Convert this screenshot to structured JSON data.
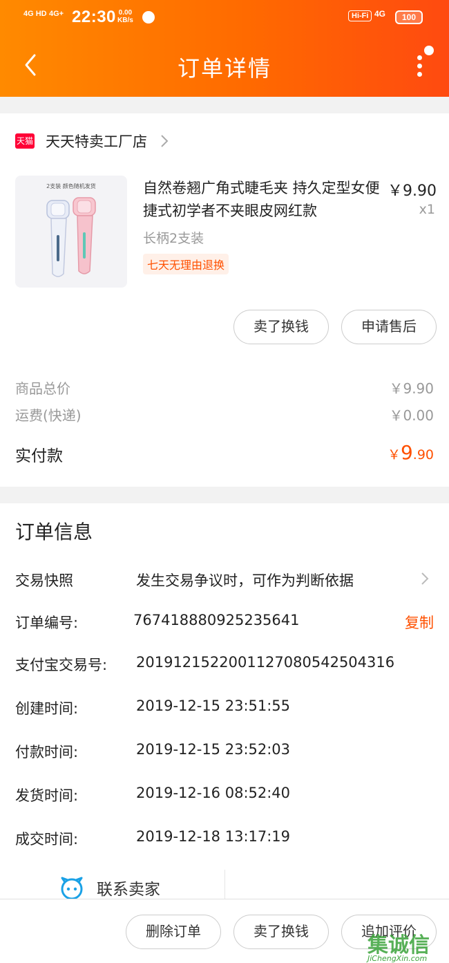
{
  "status_bar": {
    "signal1": "4G HD",
    "signal2": "4G+",
    "time": "22:30",
    "speed_value": "0.00",
    "speed_unit": "KB/s",
    "hifi": "Hi-Fi",
    "network": "4G",
    "battery": "100"
  },
  "nav": {
    "title": "订单详情"
  },
  "shop": {
    "badge": "天猫",
    "name": "天天特卖工厂店"
  },
  "product": {
    "image_caption": "2支装 颜色随机发货",
    "title": "自然卷翘广角式睫毛夹 持久定型女便捷式初学者不夹眼皮网红款",
    "price": "￥9.90",
    "quantity": "x1",
    "sku": "长柄2支装",
    "return_tag": "七天无理由退换"
  },
  "item_actions": {
    "sell_label": "卖了换钱",
    "aftersale_label": "申请售后"
  },
  "fees": {
    "goods_total_label": "商品总价",
    "goods_total_value": "￥9.90",
    "shipping_label": "运费(快递)",
    "shipping_value": "￥0.00",
    "paid_label": "实付款",
    "paid_currency": "￥",
    "paid_integer": "9",
    "paid_decimal": ".90"
  },
  "order_info": {
    "title": "订单信息",
    "snapshot_label": "交易快照",
    "snapshot_value": "发生交易争议时，可作为判断依据",
    "order_no_label": "订单编号:",
    "order_no_value": "767418880925235641",
    "copy_label": "复制",
    "alipay_label": "支付宝交易号:",
    "alipay_value": "2019121522001127080542504316",
    "created_label": "创建时间:",
    "created_value": "2019-12-15 23:51:55",
    "paid_label": "付款时间:",
    "paid_value": "2019-12-15 23:52:03",
    "shipped_label": "发货时间:",
    "shipped_value": "2019-12-16 08:52:40",
    "completed_label": "成交时间:",
    "completed_value": "2019-12-18 13:17:19",
    "contact_label": "联系卖家"
  },
  "bottom_bar": {
    "delete_label": "删除订单",
    "sell_label": "卖了换钱",
    "review_label": "追加评价"
  },
  "watermark": {
    "cn": "集诚信",
    "en": "JiChengXin.com"
  },
  "colors": {
    "header_start": "#ff8a00",
    "header_end": "#ff4a10",
    "accent": "#ff5000",
    "tmall": "#ff0036"
  }
}
